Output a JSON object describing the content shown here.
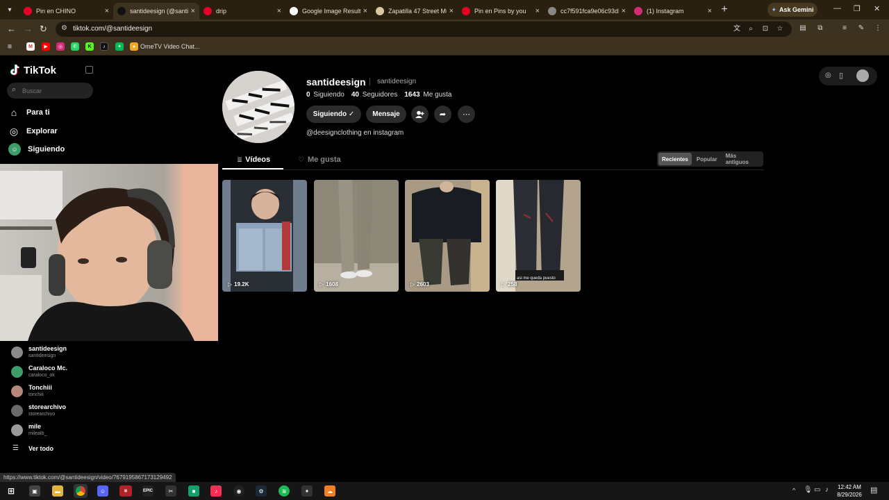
{
  "browser": {
    "tabs": [
      {
        "title": "Pin en CHINO",
        "favicon": "pinterest-icon",
        "color": "#e60023"
      },
      {
        "title": "santideesign (@santid",
        "favicon": "tiktok-icon",
        "color": "#111111"
      },
      {
        "title": "drip",
        "favicon": "pinterest-icon",
        "color": "#e60023"
      },
      {
        "title": "Google Image Result",
        "favicon": "google-icon",
        "color": "#ffffff"
      },
      {
        "title": "Zapatilla 47 Street Mu",
        "favicon": "shoe-icon",
        "color": "#d9c8a0"
      },
      {
        "title": "Pin en Pins by you",
        "favicon": "pinterest-icon",
        "color": "#e60023"
      },
      {
        "title": "cc7f591fca9e06c93db",
        "favicon": "globe-icon",
        "color": "#888888"
      },
      {
        "title": "(1) Instagram",
        "favicon": "instagram-icon",
        "color": "#d62976"
      }
    ],
    "gemini_label": "Ask Gemini",
    "url": "tiktok.com/@santideesign",
    "bookmark_label": "OmeTV Video Chat...",
    "status_url": "https://www.tiktok.com/@santideesign/video/7679195867173129492"
  },
  "sidebar": {
    "logo": "TikTok",
    "search_placeholder": "Buscar",
    "nav": [
      {
        "label": "Para ti",
        "icon": "home-icon"
      },
      {
        "label": "Explorar",
        "icon": "compass-icon"
      },
      {
        "label": "Siguiendo",
        "icon": "following-avatar-icon"
      }
    ],
    "following": [
      {
        "name": "santideesign",
        "handle": "santideesign",
        "color": "#8a8a8a"
      },
      {
        "name": "Caraloco Mc.",
        "handle": "caraloco_ok",
        "color": "#3e9b6a"
      },
      {
        "name": "Tonchiii",
        "handle": "tonchiii",
        "color": "#b5867a"
      },
      {
        "name": "storearchivo",
        "handle": "storearchivo",
        "color": "#6a6a6a"
      },
      {
        "name": "mile",
        "handle": "mileaIb_",
        "color": "#9a9a9a"
      }
    ],
    "see_all": "Ver todo"
  },
  "profile": {
    "username": "santideesign",
    "nickname": "santideesign",
    "following_count": "0",
    "following_label": "Siguiendo",
    "followers_count": "40",
    "followers_label": "Seguidores",
    "likes_count": "1643",
    "likes_label": "Me gusta",
    "follow_button": "Siguiendo ✓",
    "message_button": "Mensaje",
    "bio": "@deesignclothing en instagram",
    "tabs": [
      "Vídeos",
      "Me gusta"
    ],
    "sort_options": [
      "Recientes",
      "Popular",
      "Más antiguos"
    ],
    "videos": [
      {
        "views": "19.2K",
        "bg": "#6f7d8e"
      },
      {
        "views": "1608",
        "bg": "#8a8578"
      },
      {
        "views": "2603",
        "bg": "#6b5f52"
      },
      {
        "views": "258",
        "bg": "#5d5c59",
        "caption": "asi me queda puesto"
      }
    ]
  },
  "taskbar": {
    "time": "12:42 AM",
    "date": "8/29/2026"
  }
}
